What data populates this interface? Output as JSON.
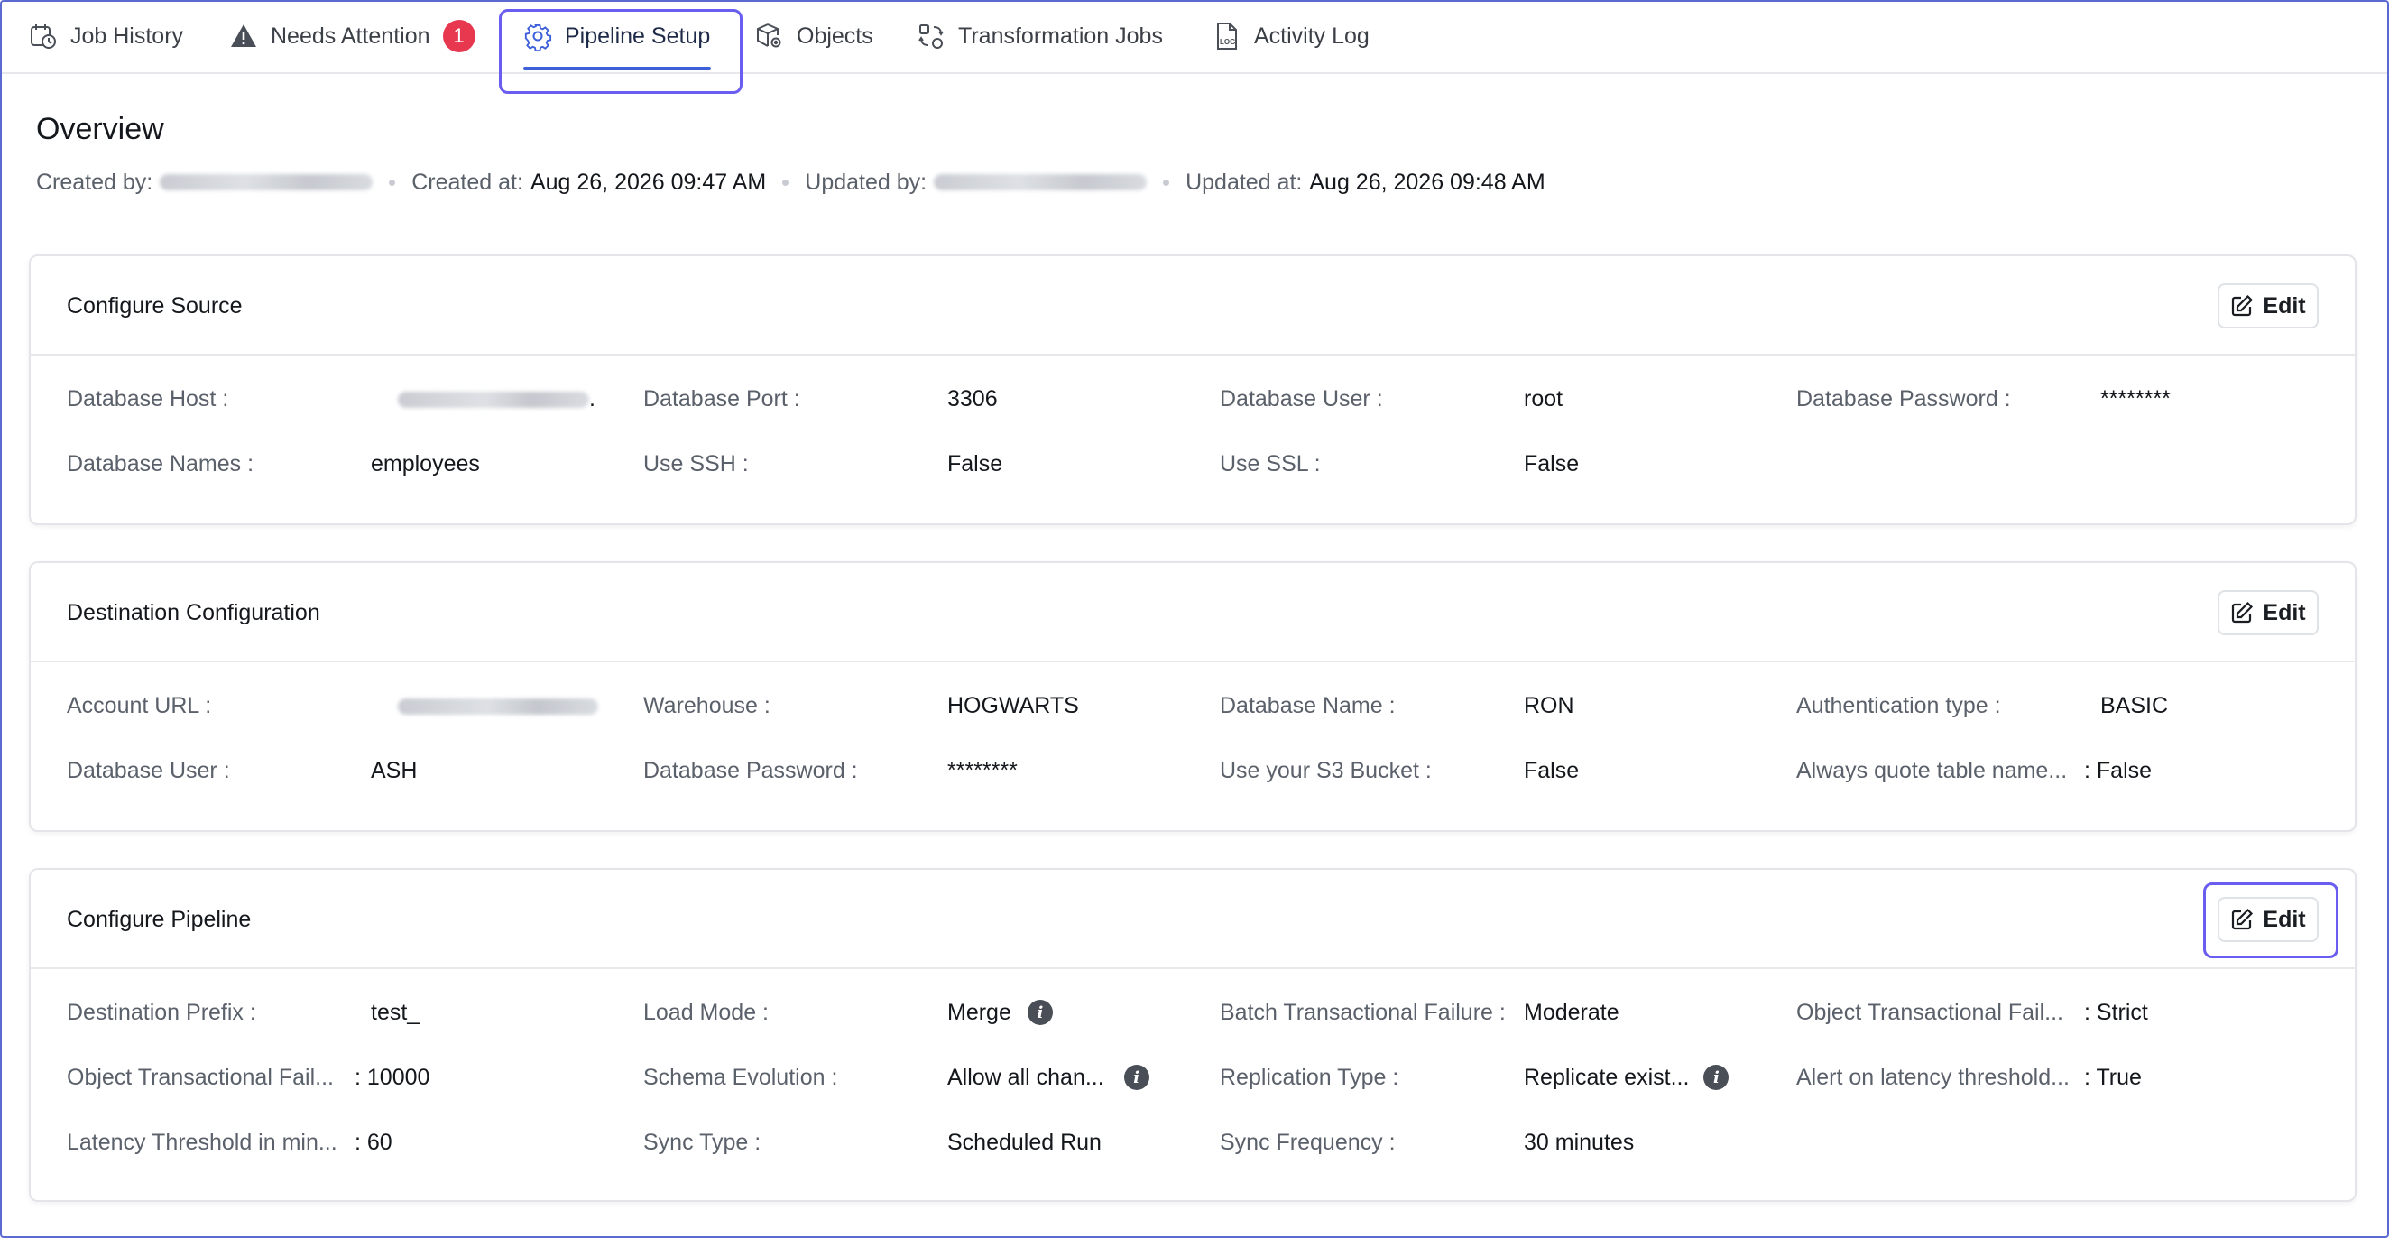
{
  "tabs": [
    {
      "label": "Job History"
    },
    {
      "label": "Needs Attention",
      "badge": "1"
    },
    {
      "label": "Pipeline Setup"
    },
    {
      "label": "Objects"
    },
    {
      "label": "Transformation Jobs"
    },
    {
      "label": "Activity Log"
    }
  ],
  "overview": {
    "title": "Overview",
    "created_by_label": "Created by:",
    "created_at_label": "Created at:",
    "created_at": "Aug 26, 2026 09:47 AM",
    "updated_by_label": "Updated by:",
    "updated_at_label": "Updated at:",
    "updated_at": "Aug 26, 2026 09:48 AM"
  },
  "edit_label": "Edit",
  "source": {
    "title": "Configure Source",
    "fields": [
      {
        "label": "Database Host :",
        "value": "."
      },
      {
        "label": "Database Port :",
        "value": "3306"
      },
      {
        "label": "Database User :",
        "value": "root"
      },
      {
        "label": "Database Password :",
        "value": "********"
      },
      {
        "label": "Database Names :",
        "value": "employees"
      },
      {
        "label": "Use SSH :",
        "value": "False"
      },
      {
        "label": "Use SSL :",
        "value": "False"
      }
    ]
  },
  "destination": {
    "title": "Destination Configuration",
    "fields": [
      {
        "label": "Account URL :",
        "value": ""
      },
      {
        "label": "Warehouse :",
        "value": "HOGWARTS"
      },
      {
        "label": "Database Name :",
        "value": "RON"
      },
      {
        "label": "Authentication type :",
        "value": "BASIC"
      },
      {
        "label": "Database User :",
        "value": "ASH"
      },
      {
        "label": "Database Password :",
        "value": "********"
      },
      {
        "label": "Use your S3 Bucket :",
        "value": "False"
      },
      {
        "label": "Always quote table name...",
        "value": ": False"
      }
    ]
  },
  "pipeline": {
    "title": "Configure Pipeline",
    "fields": [
      {
        "label": "Destination Prefix :",
        "value": "test_"
      },
      {
        "label": "Load Mode :",
        "value": "Merge"
      },
      {
        "label": "Batch Transactional Failure :",
        "value": "Moderate"
      },
      {
        "label": "Object Transactional Fail...",
        "value": ": Strict"
      },
      {
        "label": "Object Transactional Fail...",
        "value": ": 10000"
      },
      {
        "label": "Schema Evolution :",
        "value": "Allow all chan..."
      },
      {
        "label": "Replication Type :",
        "value": "Replicate exist..."
      },
      {
        "label": "Alert on latency threshold...",
        "value": ": True"
      },
      {
        "label": "Latency Threshold in min...",
        "value": ": 60"
      },
      {
        "label": "Sync Type :",
        "value": "Scheduled Run"
      },
      {
        "label": "Sync Frequency :",
        "value": "30 minutes"
      }
    ]
  },
  "icons": {
    "job_history": "calendar-clock-icon",
    "needs_attention": "warning-icon",
    "pipeline_setup": "gear-icon",
    "objects": "cube-gear-icon",
    "transformation_jobs": "transform-icon",
    "activity_log": "log-file-icon",
    "edit": "edit-icon",
    "info": "info-icon"
  },
  "colors": {
    "accent": "#3d5fd9",
    "focus_ring": "#6a5ef0",
    "badge": "#e8384f"
  }
}
